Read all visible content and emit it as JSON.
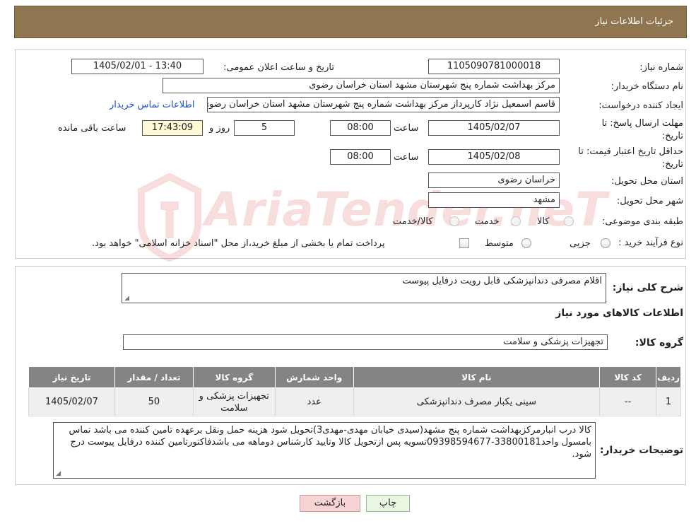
{
  "header": {
    "title": "جزئیات اطلاعات نیاز"
  },
  "form": {
    "need_number_label": "شماره نیاز:",
    "need_number": "1105090781000018",
    "announce_label": "تاریخ و ساعت اعلان عمومی:",
    "announce_value": "1405/02/01 - 13:40",
    "buyer_org_label": "نام دستگاه خریدار:",
    "buyer_org": "مرکز بهداشت شماره پنج شهرستان مشهد استان خراسان رضوی",
    "creator_label": "ایجاد کننده درخواست:",
    "creator": "قاسم  اسمعیل نژاد کارپرداز مرکز بهداشت شماره پنج شهرستان مشهد استان خراسان رضوی",
    "contact_link": "اطلاعات تماس خریدار",
    "reply_deadline_label": "مهلت ارسال پاسخ: تا تاریخ:",
    "reply_date": "1405/02/07",
    "time_label": "ساعت",
    "reply_time": "08:00",
    "days_value": "5",
    "days_label": "روز و",
    "remaining_time": "17:43:09",
    "remaining_label": "ساعت باقی مانده",
    "price_validity_label": "حداقل تاریخ اعتبار قیمت: تا تاریخ:",
    "price_date": "1405/02/08",
    "price_time": "08:00",
    "province_label": "استان محل تحویل:",
    "province": "خراسان رضوی",
    "city_label": "شهر محل تحویل:",
    "city": "مشهد",
    "category_label": "طبقه بندی موضوعی:",
    "category_options": [
      "کالا",
      "خدمت",
      "کالا/خدمت"
    ],
    "process_label": "نوع فرآیند خرید :",
    "process_options": [
      "جزیی",
      "متوسط"
    ],
    "payment_note": "پرداخت تمام یا بخشی از مبلغ خرید،از محل \"اسناد خزانه اسلامی\" خواهد بود."
  },
  "details": {
    "description_label": "شرح کلی نیاز:",
    "description": "اقلام مصرفی دندانپزشکی قابل رویت درفایل پیوست",
    "goods_info_title": "اطلاعات کالاهای مورد نیاز",
    "goods_group_label": "گروه کالا:",
    "goods_group": "تجهیزات پزشکی و سلامت",
    "table": {
      "headers": [
        "ردیف",
        "کد کالا",
        "نام کالا",
        "واحد شمارش",
        "گروه کالا",
        "تعداد / مقدار",
        "تاریخ نیاز"
      ],
      "rows": [
        [
          "1",
          "--",
          "سینی یکبار مصرف دندانپزشکی",
          "عدد",
          "تجهیزات پزشکی و سلامت",
          "50",
          "1405/02/07"
        ]
      ]
    },
    "buyer_notes_label": "توضیحات خریدار:",
    "buyer_notes": "کالا درب انبارمرکزبهداشت شماره پنج مشهد(سیدی خیابان مهدی-مهدی3)تحویل شود هزینه حمل ونقل برعهده تامین کننده می باشد  تماس بامسول واحد33800181-09398594677تسویه پس ازتحویل کالا وتایید کارشناس دوماهه می باشدفاکتورتامین کننده درفایل پیوست درج شود."
  },
  "buttons": {
    "back": "بازگشت",
    "print": "چاپ"
  },
  "watermark": {
    "text": "AriaTender.neT"
  },
  "colors": {
    "header_bg": "#8f7650",
    "table_header_bg": "#848484",
    "link": "#1a4fd6",
    "back_button_bg": "#f7d3d3",
    "print_button_bg": "#e8f6e2"
  }
}
